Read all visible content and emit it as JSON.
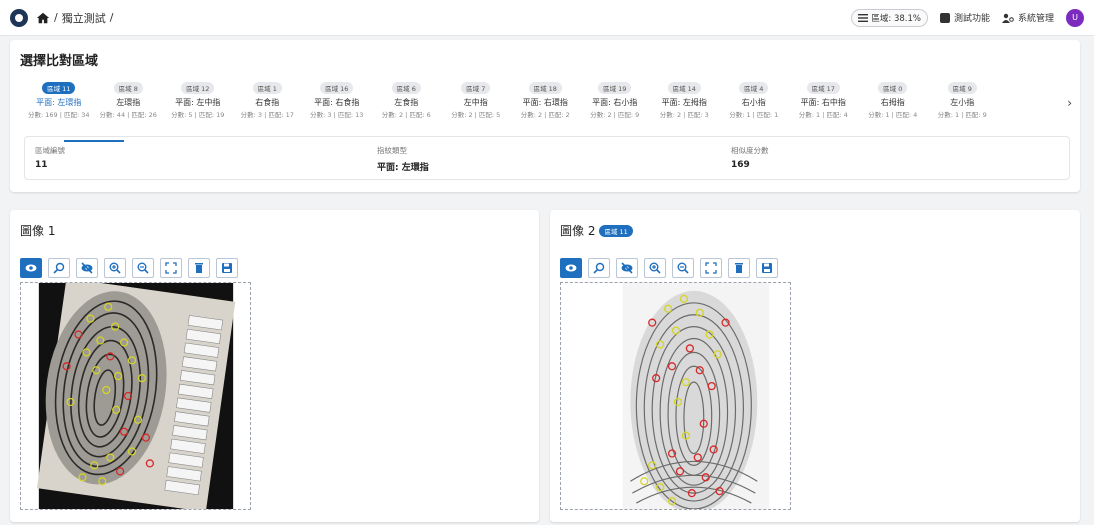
{
  "breadcrumb": {
    "separator_1": "/",
    "current": "獨立測試",
    "separator_2": "/"
  },
  "topbar": {
    "progress": "區域: 38.1%",
    "test_function": "測試功能",
    "system_admin": "系統管理",
    "avatar_letter": "U"
  },
  "select_card": {
    "title": "選擇比對區域",
    "regions": [
      {
        "badge": "區域 11",
        "name": "平面: 左環指",
        "score": "分數: 169 | 匹配: 34",
        "active": true
      },
      {
        "badge": "區域 8",
        "name": "左環指",
        "score": "分數: 44 | 匹配: 26"
      },
      {
        "badge": "區域 12",
        "name": "平面: 左中指",
        "score": "分數: 5 | 匹配: 19"
      },
      {
        "badge": "區域 1",
        "name": "右食指",
        "score": "分數: 3 | 匹配: 17"
      },
      {
        "badge": "區域 16",
        "name": "平面: 右食指",
        "score": "分數: 3 | 匹配: 13"
      },
      {
        "badge": "區域 6",
        "name": "左食指",
        "score": "分數: 2 | 匹配: 6"
      },
      {
        "badge": "區域 7",
        "name": "左中指",
        "score": "分數: 2 | 匹配: 5"
      },
      {
        "badge": "區域 18",
        "name": "平面: 右環指",
        "score": "分數: 2 | 匹配: 2"
      },
      {
        "badge": "區域 19",
        "name": "平面: 右小指",
        "score": "分數: 2 | 匹配: 9"
      },
      {
        "badge": "區域 14",
        "name": "平面: 左拇指",
        "score": "分數: 2 | 匹配: 3"
      },
      {
        "badge": "區域 4",
        "name": "右小指",
        "score": "分數: 1 | 匹配: 1"
      },
      {
        "badge": "區域 17",
        "name": "平面: 右中指",
        "score": "分數: 1 | 匹配: 4"
      },
      {
        "badge": "區域 0",
        "name": "右拇指",
        "score": "分數: 1 | 匹配: 4"
      },
      {
        "badge": "區域 9",
        "name": "左小指",
        "score": "分數: 1 | 匹配: 9"
      }
    ],
    "info": {
      "region_id_label": "區域編號",
      "region_id_value": "11",
      "fingerprint_type_label": "指紋類型",
      "fingerprint_type_value": "平面: 左環指",
      "similarity_label": "相似度分數",
      "similarity_value": "169"
    }
  },
  "image1": {
    "title": "圖像 1"
  },
  "image2": {
    "title": "圖像 2",
    "badge": "區域 11"
  },
  "toolbar_icons": [
    "eye-icon",
    "zoom-search-icon",
    "eye-off-icon",
    "zoom-in-icon",
    "zoom-out-icon",
    "fullscreen-icon",
    "delete-icon",
    "save-icon"
  ],
  "colors": {
    "accent": "#1f6fbf",
    "minutia_match": "#d4d426",
    "minutia_other": "#d62828",
    "avatar": "#7b2cbf"
  }
}
